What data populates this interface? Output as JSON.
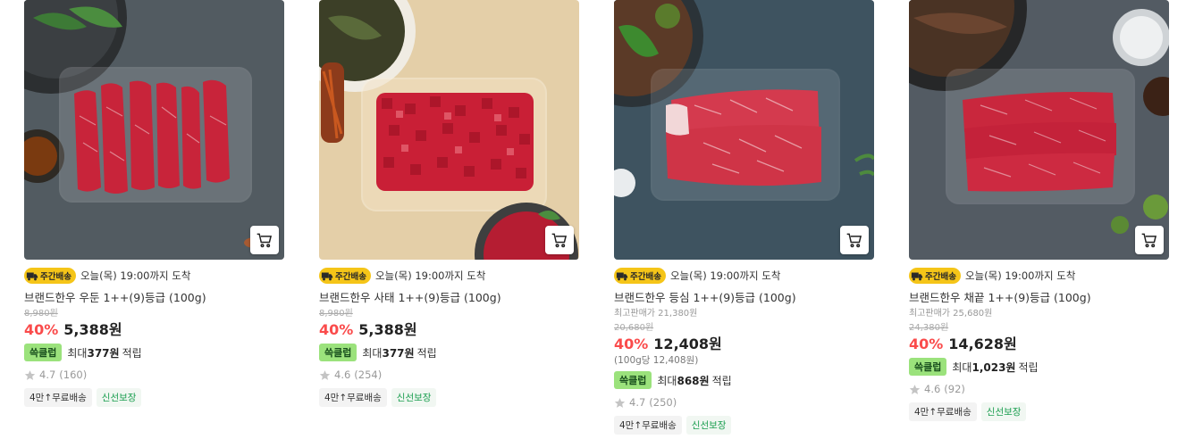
{
  "colors": {
    "discount": "#fa4b4b",
    "badge": "#f5c518",
    "ssak": "#9be27c"
  },
  "products": [
    {
      "badge": "주간배송",
      "delivery": "오늘(목) 19:00까지 도착",
      "name": "브랜드한우 우둔 1++(9)등급 (100g)",
      "best_price": "",
      "original_price": "8,980원",
      "discount": "40%",
      "price": "5,388원",
      "unit_price": "",
      "points_badge": "쓱클럽",
      "points_prefix": "최대",
      "points_amount": "377원",
      "points_suffix": "적립",
      "rating": "4.7",
      "reviews": "(160)",
      "tag1": "4만↑무료배송",
      "tag2": "신선보장",
      "cart_icon": "cart-icon"
    },
    {
      "badge": "주간배송",
      "delivery": "오늘(목) 19:00까지 도착",
      "name": "브랜드한우 사태 1++(9)등급 (100g)",
      "best_price": "",
      "original_price": "8,980원",
      "discount": "40%",
      "price": "5,388원",
      "unit_price": "",
      "points_badge": "쓱클럽",
      "points_prefix": "최대",
      "points_amount": "377원",
      "points_suffix": "적립",
      "rating": "4.6",
      "reviews": "(254)",
      "tag1": "4만↑무료배송",
      "tag2": "신선보장",
      "cart_icon": "cart-icon"
    },
    {
      "badge": "주간배송",
      "delivery": "오늘(목) 19:00까지 도착",
      "name": "브랜드한우 등심 1++(9)등급 (100g)",
      "best_price": "최고판매가 21,380원",
      "original_price": "20,680원",
      "discount": "40%",
      "price": "12,408원",
      "unit_price": "(100g당 12,408원)",
      "points_badge": "쓱클럽",
      "points_prefix": "최대",
      "points_amount": "868원",
      "points_suffix": "적립",
      "rating": "4.7",
      "reviews": "(250)",
      "tag1": "4만↑무료배송",
      "tag2": "신선보장",
      "cart_icon": "cart-icon"
    },
    {
      "badge": "주간배송",
      "delivery": "오늘(목) 19:00까지 도착",
      "name": "브랜드한우 채끝 1++(9)등급 (100g)",
      "best_price": "최고판매가 25,680원",
      "original_price": "24,380원",
      "discount": "40%",
      "price": "14,628원",
      "unit_price": "",
      "points_badge": "쓱클럽",
      "points_prefix": "최대",
      "points_amount": "1,023원",
      "points_suffix": "적립",
      "rating": "4.6",
      "reviews": "(92)",
      "tag1": "4만↑무료배송",
      "tag2": "신선보장",
      "cart_icon": "cart-icon"
    }
  ]
}
